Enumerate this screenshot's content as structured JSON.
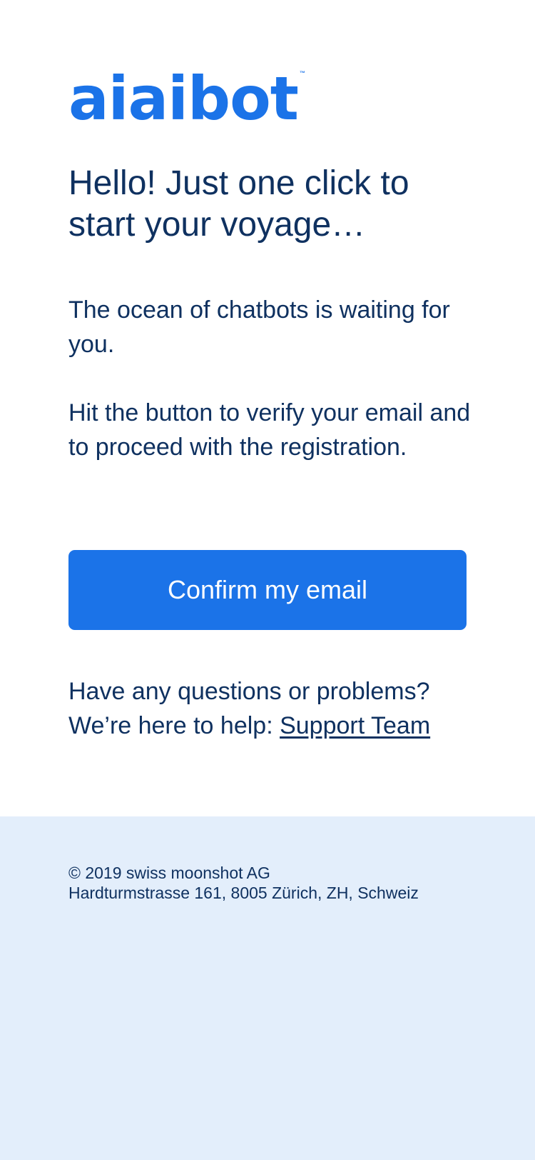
{
  "logo": {
    "text": "aiaibot",
    "trademark": "™"
  },
  "headline": "Hello! Just one click to start your voyage…",
  "body": {
    "paragraph_1": "The ocean of chatbots is waiting for you.",
    "paragraph_2": "Hit the button to verify your email and to proceed with the registration."
  },
  "cta": {
    "confirm_label": "Confirm my email"
  },
  "help": {
    "question": "Have any questions or problems?",
    "prefix": "We’re here to help: ",
    "link_label": "Support Team"
  },
  "footer": {
    "copyright": "© 2019 swiss moonshot AG",
    "address": "Hardturmstrasse 161, 8005 Zürich, ZH, Schweiz"
  },
  "colors": {
    "brand": "#1b73e8",
    "text": "#0f3160",
    "footer_bg": "#e3eefb",
    "background": "#ffffff"
  }
}
